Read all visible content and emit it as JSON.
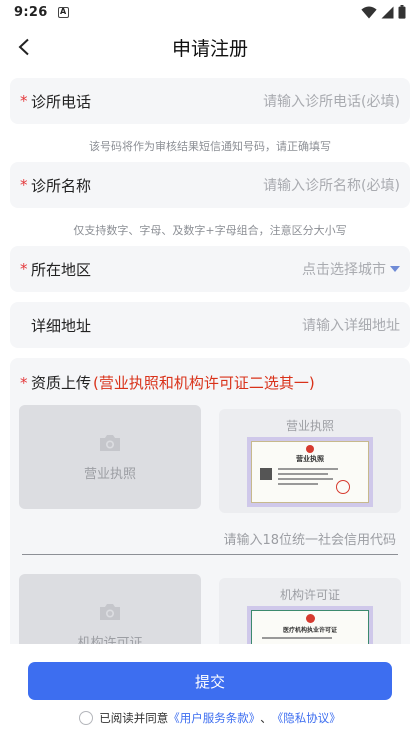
{
  "status": {
    "time": "9:26",
    "badge": "A"
  },
  "nav": {
    "title": "申请注册"
  },
  "fields": [
    {
      "label": "诊所电话",
      "placeholder": "请输入诊所电话(必填)",
      "required": true
    },
    {
      "label": "诊所名称",
      "placeholder": "请输入诊所名称(必填)",
      "required": true
    },
    {
      "label": "所在地区",
      "placeholder": "点击选择城市",
      "required": true
    },
    {
      "label": "详细地址",
      "placeholder": "请输入详细地址",
      "required": false
    }
  ],
  "hints": {
    "phone": "该号码将作为审核结果短信通知号码，请正确填写",
    "name": "仅支持数字、字母、及数字+字母组合，注意区分大小写"
  },
  "qualification": {
    "label": "资质上传",
    "note": "(营业执照和机构许可证二选其一)",
    "license_upload": "营业执照",
    "license_sample_title": "营业执照",
    "license_sample_doc_title": "营业执照",
    "credit_placeholder": "请输入18位统一社会信用代码",
    "permit_upload": "机构许可证",
    "permit_sample_title": "机构许可证",
    "permit_sample_doc_title": "医疗机构执业许可证"
  },
  "footer": {
    "submit": "提交",
    "agree_prefix": "已阅读并同意",
    "terms": "《用户服务条款》",
    "separator": "、",
    "privacy": "《隐私协议》"
  },
  "colors": {
    "primary": "#3d6ef0",
    "required": "#e4393c",
    "note": "#d9321a"
  }
}
